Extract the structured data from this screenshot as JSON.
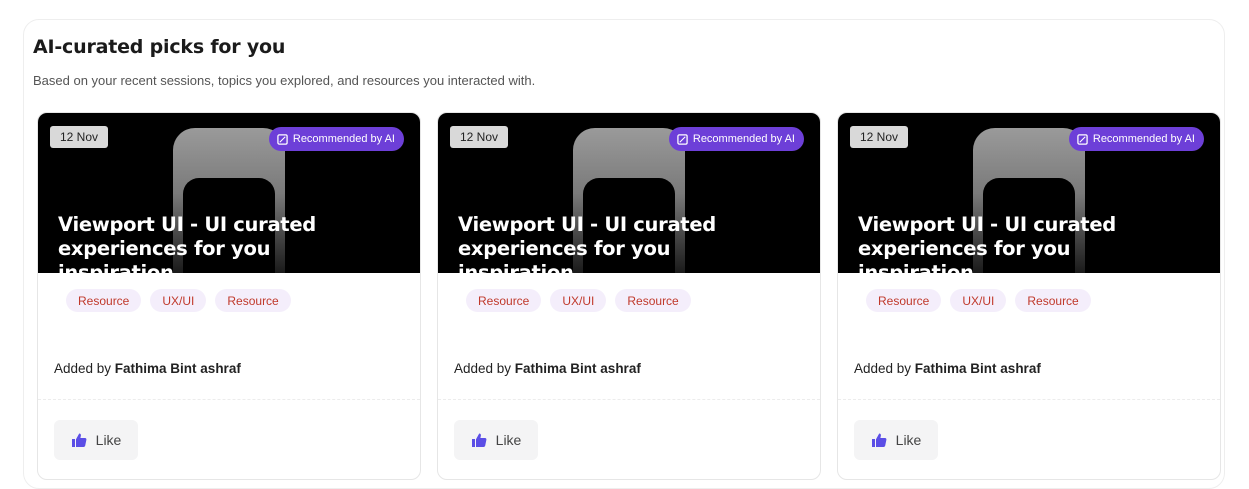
{
  "section": {
    "title": "AI-curated picks for you",
    "subtitle": "Based on your recent sessions, topics you explored, and resources you interacted with."
  },
  "colors": {
    "ai_badge": "#6d3fd8",
    "tag_background": "#f4eefb",
    "tag_text": "#c0392b",
    "like_icon": "#5b4ee6"
  },
  "cards": [
    {
      "date": "12 Nov",
      "badge": "Recommended by AI",
      "title": "Viewport UI - UI curated experiences for you inspiration.",
      "tags": [
        "Resource",
        "UX/UI",
        "Resource"
      ],
      "added_by_prefix": "Added by",
      "author": "Fathima Bint ashraf",
      "like_label": "Like"
    },
    {
      "date": "12 Nov",
      "badge": "Recommended by AI",
      "title": "Viewport UI - UI curated experiences for you inspiration.",
      "tags": [
        "Resource",
        "UX/UI",
        "Resource"
      ],
      "added_by_prefix": "Added by",
      "author": "Fathima Bint ashraf",
      "like_label": "Like"
    },
    {
      "date": "12 Nov",
      "badge": "Recommended by AI",
      "title": "Viewport UI - UI curated experiences for you inspiration.",
      "tags": [
        "Resource",
        "UX/UI",
        "Resource"
      ],
      "added_by_prefix": "Added by",
      "author": "Fathima Bint ashraf",
      "like_label": "Like"
    }
  ]
}
